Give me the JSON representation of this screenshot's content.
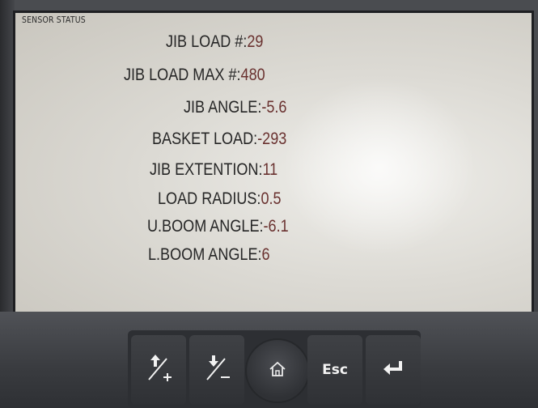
{
  "screen": {
    "header": "SENSOR STATUS",
    "rows": [
      {
        "label": "JIB LOAD #:",
        "value": "29"
      },
      {
        "label": "JIB LOAD MAX #:",
        "value": "480"
      },
      {
        "label": "JIB ANGLE:",
        "value": "-5.6"
      },
      {
        "label": "BASKET LOAD:",
        "value": "-293"
      },
      {
        "label": "JIB EXTENTION:",
        "value": "11"
      },
      {
        "label": "LOAD RADIUS:",
        "value": "0.5"
      },
      {
        "label": "U.BOOM ANGLE:",
        "value": "-6.1"
      },
      {
        "label": "L.BOOM ANGLE:",
        "value": "6"
      }
    ]
  },
  "keypad": {
    "esc_label": "Esc",
    "icons": [
      "up-plus-icon",
      "down-minus-icon",
      "home-icon",
      "enter-icon"
    ]
  },
  "colors": {
    "label_text": "#262626",
    "value_text": "#6a3230",
    "screen_bg": "#dcdad4",
    "bezel": "#3e4044"
  }
}
